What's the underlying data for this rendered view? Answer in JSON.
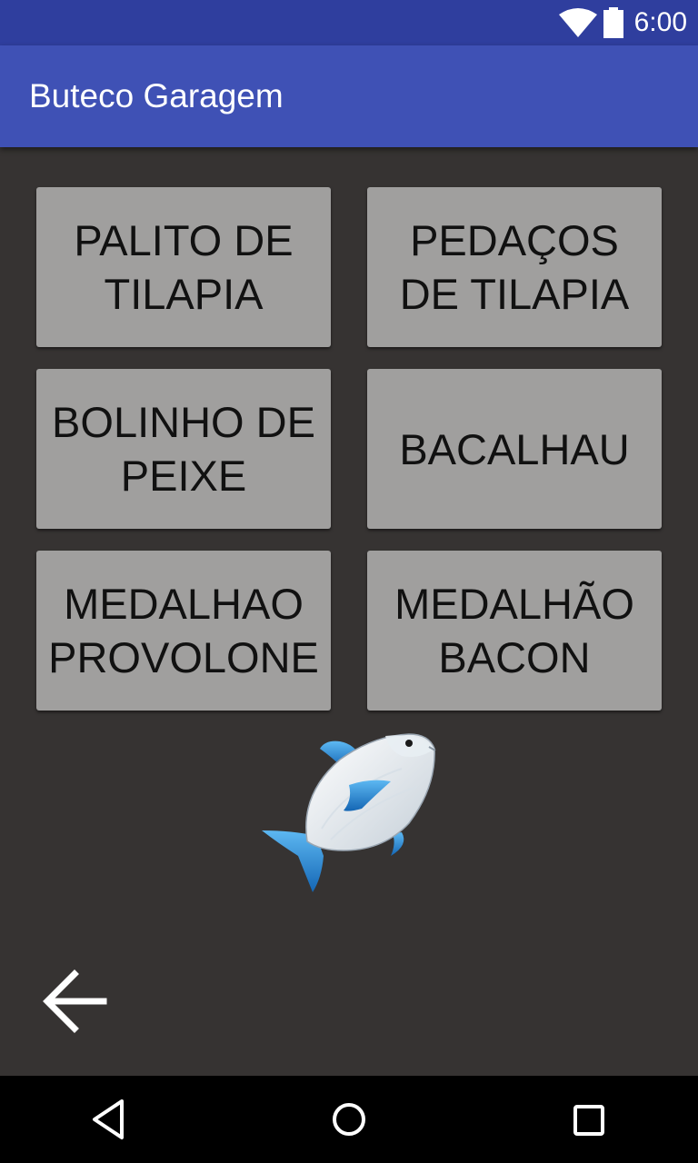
{
  "status_bar": {
    "time": "6:00",
    "icons": [
      "wifi-icon",
      "battery-icon"
    ]
  },
  "app_bar": {
    "title": "Buteco Garagem"
  },
  "menu": {
    "items": [
      {
        "label": "PALITO DE\nTILAPIA"
      },
      {
        "label": "PEDAÇOS\nDE TILAPIA"
      },
      {
        "label": "BOLINHO DE\nPEIXE"
      },
      {
        "label": "BACALHAU"
      },
      {
        "label": "MEDALHAO\nPROVOLONE"
      },
      {
        "label": "MEDALHÃO\nBACON"
      }
    ]
  },
  "illustration": {
    "icon": "fish-icon"
  },
  "back_button": {
    "icon": "arrow-back-icon"
  },
  "nav_bar": {
    "icons": [
      "nav-back-icon",
      "nav-home-icon",
      "nav-recents-icon"
    ]
  },
  "colors": {
    "status_bar": "#2f3e9e",
    "app_bar": "#3f51b5",
    "background": "#363332",
    "button": "#a09f9e",
    "button_text": "#111111",
    "fish_blue": "#1e88d6"
  }
}
